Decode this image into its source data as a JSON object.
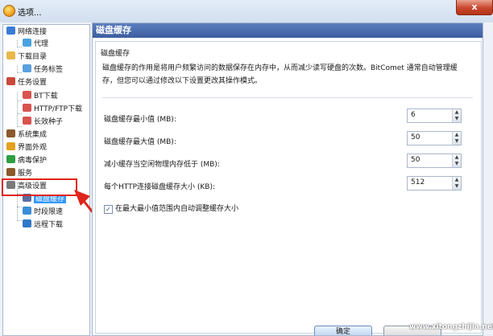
{
  "window": {
    "title": "选项...",
    "close_glyph": "x"
  },
  "tree": {
    "items": [
      {
        "label": "网络连接",
        "icon": "network-icon",
        "color": "#3b7bd6"
      },
      {
        "label": "代理",
        "icon": "proxy-icon",
        "color": "#4aa3df"
      },
      {
        "label": "下载目录",
        "icon": "folder-icon",
        "color": "#e8b84a"
      },
      {
        "label": "任务标签",
        "icon": "tag-icon",
        "color": "#5ba0e0"
      },
      {
        "label": "任务设置",
        "icon": "task-settings-icon",
        "color": "#c94a3a"
      },
      {
        "label": "BT下载",
        "icon": "bt-icon",
        "color": "#d9534f"
      },
      {
        "label": "HTTP/FTP下载",
        "icon": "http-icon",
        "color": "#d9534f"
      },
      {
        "label": "长效种子",
        "icon": "seed-icon",
        "color": "#d9534f"
      },
      {
        "label": "系统集成",
        "icon": "integration-icon",
        "color": "#8a5a2b"
      },
      {
        "label": "界面外观",
        "icon": "appearance-icon",
        "color": "#e2a21f"
      },
      {
        "label": "病毒保护",
        "icon": "shield-icon",
        "color": "#2f9e44"
      },
      {
        "label": "服务",
        "icon": "service-icon",
        "color": "#8a5a2b"
      },
      {
        "label": "高级设置",
        "icon": "advanced-icon",
        "color": "#7a7a7a"
      },
      {
        "label": "磁盘缓存",
        "icon": "disk-cache-icon",
        "color": "#5a6ea0"
      },
      {
        "label": "时段限速",
        "icon": "schedule-icon",
        "color": "#3b8ed6"
      },
      {
        "label": "远程下载",
        "icon": "remote-icon",
        "color": "#2f77c8"
      }
    ],
    "selected_index": 13
  },
  "panel": {
    "header": "磁盘缓存",
    "group_title": "磁盘缓存",
    "description_line1": "磁盘缓存的作用是将用户频繁访问的数据保存在内存中，从而减少读写硬盘的次数。BitComet 通常自动管理缓",
    "description_line2": "存，但您可以通过修改以下设置更改其操作模式。",
    "fields": [
      {
        "label": "磁盘缓存最小值 (MB):",
        "value": "6"
      },
      {
        "label": "磁盘缓存最大值 (MB):",
        "value": "50"
      },
      {
        "label": "减小缓存当空闲物理内存低于 (MB):",
        "value": "50"
      },
      {
        "label": "每个HTTP连接磁盘缓存大小 (KB):",
        "value": "512"
      }
    ],
    "checkbox": {
      "label": "在最大最小值范围内自动调整缓存大小",
      "checked": true
    }
  },
  "buttons": {
    "ok": "确定"
  },
  "watermark": "www.xitongzhijia.net",
  "colors": {
    "highlight": "#e0261c",
    "selection": "#3399ff",
    "header": "#3b5d9e"
  }
}
